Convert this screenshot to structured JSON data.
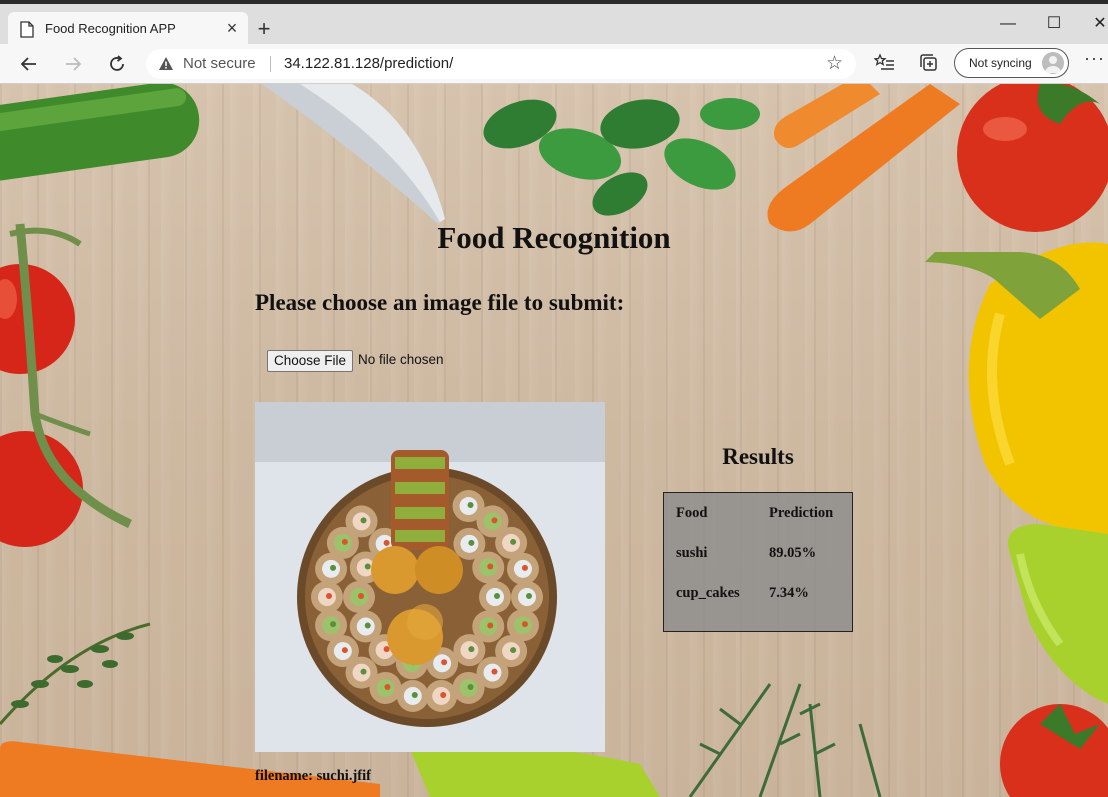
{
  "browser": {
    "tab_title": "Food Recognition APP",
    "tab_close": "×",
    "new_tab": "+",
    "window_controls": {
      "minimize": "—",
      "maximize": "☐",
      "close": "✕"
    },
    "security_label": "Not secure",
    "url": "34.122.81.128/prediction/",
    "sync_label": "Not syncing",
    "more_label": "···"
  },
  "page": {
    "title": "Food Recognition",
    "subtitle": "Please choose an image file to submit:",
    "file_button": "Choose File",
    "file_status": "No file chosen",
    "filename_label": "filename: suchi.jfif"
  },
  "results": {
    "heading": "Results",
    "headers": [
      "Food",
      "Prediction"
    ],
    "rows": [
      {
        "food": "sushi",
        "prediction": "89.05%"
      },
      {
        "food": "cup_cakes",
        "prediction": "7.34%"
      }
    ]
  },
  "colors": {
    "wood": "#cdb8a0",
    "tomato": "#d9301c",
    "pepper_yellow": "#f2c400",
    "pepper_green": "#a8d12e",
    "carrot": "#ee7a22",
    "leaf": "#2e7d32",
    "table_bg": "#8c8c8c"
  }
}
